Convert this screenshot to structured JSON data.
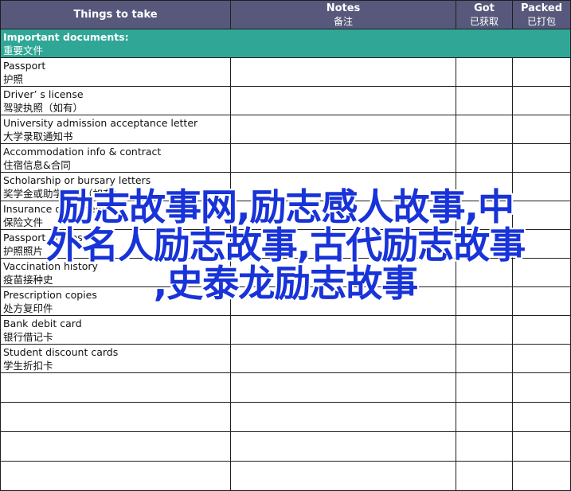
{
  "header": {
    "things": "Things to take",
    "notes_en": "Notes",
    "notes_zh": "备注",
    "got_en": "Got",
    "got_zh": "已获取",
    "packed_en": "Packed",
    "packed_zh": "已打包"
  },
  "section": {
    "en": "Important documents:",
    "zh": "重要文件"
  },
  "items": [
    {
      "en": "Passport",
      "zh": "护照"
    },
    {
      "en": "Driver’ s license",
      "zh": "驾驶执照（如有）"
    },
    {
      "en": "University admission acceptance letter",
      "zh": "大学录取通知书"
    },
    {
      "en": "Accommodation info & contract",
      "zh": "住宿信息&合同"
    },
    {
      "en": "Scholarship or bursary letters",
      "zh": "奖学金或助学金信（如有）"
    },
    {
      "en": "Insurance documents",
      "zh": "保险文件"
    },
    {
      "en": "Passport photos",
      "zh": "护照照片"
    },
    {
      "en": "Vaccination history",
      "zh": "疫苗接种史"
    },
    {
      "en": "Prescription copies",
      "zh": "处方复印件"
    },
    {
      "en": "Bank debit card",
      "zh": "银行借记卡"
    },
    {
      "en": "Student discount cards",
      "zh": "学生折扣卡"
    }
  ],
  "watermark": {
    "line1": "励志故事网,励志感人故事,中",
    "line2": "外名人励志故事,古代励志故事",
    "line3": ",史泰龙励志故事"
  }
}
